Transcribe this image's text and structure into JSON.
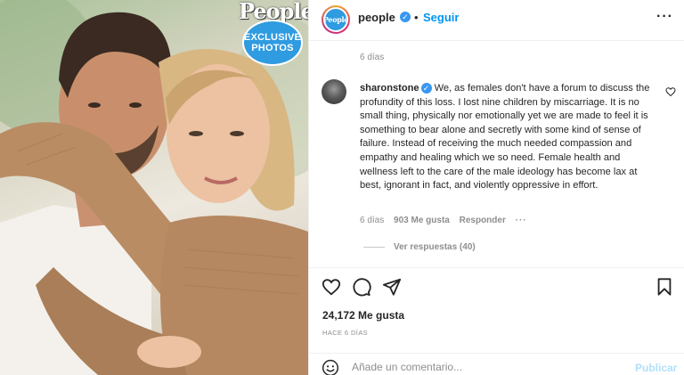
{
  "photo": {
    "badge_logo": "People",
    "badge_line1": "EXCLUSIVE",
    "badge_line2": "PHOTOS"
  },
  "header": {
    "avatar_logo": "People",
    "username": "people",
    "separator": "•",
    "follow_label": "Seguir",
    "more_label": "···"
  },
  "caption": {
    "time": "6 días"
  },
  "comment": {
    "username": "sharonstone",
    "text": "We, as females don't have a forum to discuss the profundity of this loss. I lost nine children by miscarriage. It is no small thing, physically nor emotionally yet we are made to feel it is something to bear alone and secretly with some kind of sense of failure. Instead of receiving the much needed compassion and empathy and healing which we so need. Female health and wellness left to the care of the male ideology has become lax at best, ignorant in fact, and violently oppressive in effort.",
    "time": "6 días",
    "likes": "903 Me gusta",
    "reply_label": "Responder",
    "more_label": "···",
    "view_replies": "Ver respuestas (40)"
  },
  "actions": {
    "likes": "24,172 Me gusta",
    "posted": "HACE 6 DÍAS"
  },
  "comment_box": {
    "placeholder": "Añade un comentario...",
    "publish_label": "Publicar"
  },
  "icons": {
    "verified": "verified-badge-icon",
    "heart": "heart-icon",
    "comment": "comment-icon",
    "share": "paper-plane-icon",
    "save": "bookmark-icon",
    "emoji": "smiley-icon"
  },
  "colors": {
    "link_blue": "#0095f6",
    "verified_blue": "#3897f0",
    "muted": "#8e8e8e",
    "publish_disabled": "#b2dffc",
    "badge_blue": "#2f9be0"
  }
}
